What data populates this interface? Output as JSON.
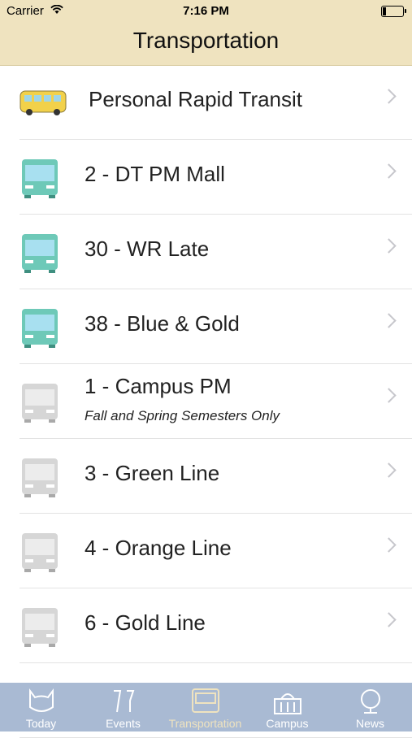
{
  "status_bar": {
    "carrier": "Carrier",
    "time": "7:16 PM"
  },
  "header": {
    "title": "Transportation"
  },
  "routes": [
    {
      "label": "Personal Rapid Transit",
      "subtitle": "",
      "icon": "prt-vehicle-icon",
      "color": "#f2d14a"
    },
    {
      "label": "2 - DT PM Mall",
      "subtitle": "",
      "icon": "bus-icon",
      "color": "#6ec9b8"
    },
    {
      "label": "30 - WR Late",
      "subtitle": "",
      "icon": "bus-icon",
      "color": "#6ec9b8"
    },
    {
      "label": "38 - Blue & Gold",
      "subtitle": "",
      "icon": "bus-icon",
      "color": "#6ec9b8"
    },
    {
      "label": "1 - Campus PM",
      "subtitle": "Fall and Spring Semesters Only",
      "icon": "bus-icon",
      "color": "#cfcfcf"
    },
    {
      "label": "3 - Green Line",
      "subtitle": "",
      "icon": "bus-icon",
      "color": "#cfcfcf"
    },
    {
      "label": "4 - Orange Line",
      "subtitle": "",
      "icon": "bus-icon",
      "color": "#cfcfcf"
    },
    {
      "label": "6 - Gold Line",
      "subtitle": "",
      "icon": "bus-icon",
      "color": "#cfcfcf"
    }
  ],
  "tabs": [
    {
      "label": "Today",
      "icon": "cat-face-icon",
      "active": false
    },
    {
      "label": "Events",
      "icon": "champagne-glasses-icon",
      "active": false
    },
    {
      "label": "Transportation",
      "icon": "bus-icon",
      "active": true
    },
    {
      "label": "Campus",
      "icon": "capitol-building-icon",
      "active": false
    },
    {
      "label": "News",
      "icon": "globe-icon",
      "active": false
    }
  ]
}
